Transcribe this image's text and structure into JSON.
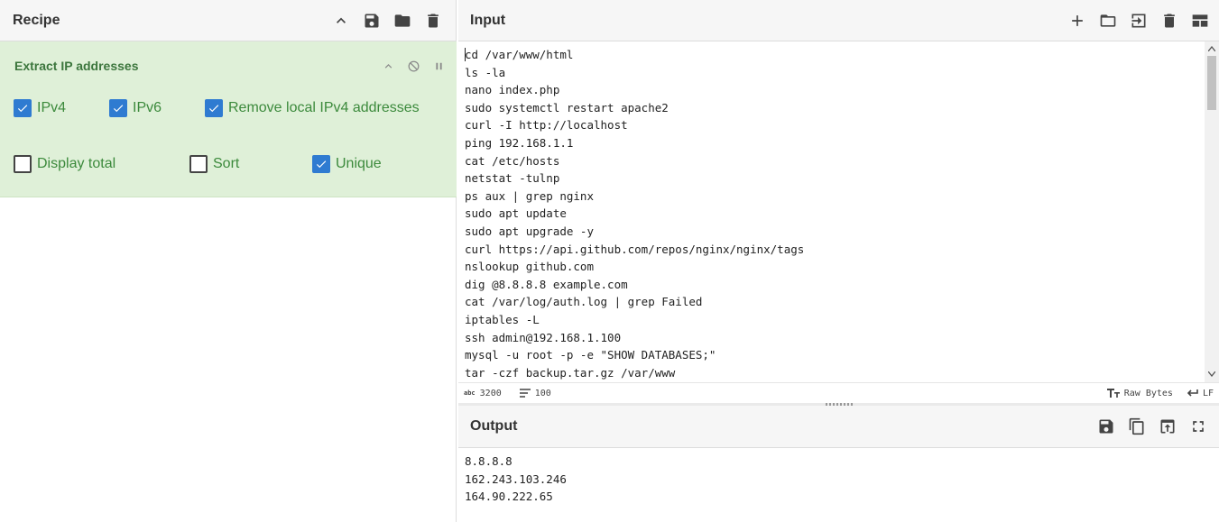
{
  "recipe": {
    "title": "Recipe",
    "operation": {
      "name": "Extract IP addresses",
      "options": [
        {
          "label": "IPv4",
          "checked": true
        },
        {
          "label": "IPv6",
          "checked": true
        },
        {
          "label": "Remove local IPv4 addresses",
          "checked": true
        },
        {
          "label": "Display total",
          "checked": false
        },
        {
          "label": "Sort",
          "checked": false
        },
        {
          "label": "Unique",
          "checked": true
        }
      ]
    }
  },
  "input": {
    "title": "Input",
    "lines": [
      "cd /var/www/html",
      "ls -la",
      "nano index.php",
      "sudo systemctl restart apache2",
      "curl -I http://localhost",
      "ping 192.168.1.1",
      "cat /etc/hosts",
      "netstat -tulnp",
      "ps aux | grep nginx",
      "sudo apt update",
      "sudo apt upgrade -y",
      "curl https://api.github.com/repos/nginx/nginx/tags",
      "nslookup github.com",
      "dig @8.8.8.8 example.com",
      "cat /var/log/auth.log | grep Failed",
      "iptables -L",
      "ssh admin@192.168.1.100",
      "mysql -u root -p -e \"SHOW DATABASES;\"",
      "tar -czf backup.tar.gz /var/www"
    ],
    "status": {
      "char_icon": "abc",
      "chars": "3200",
      "lines": "100",
      "encoding": "Raw Bytes",
      "eol": "LF"
    }
  },
  "output": {
    "title": "Output",
    "lines": [
      "8.8.8.8",
      "162.243.103.246",
      "164.90.222.65"
    ]
  },
  "colors": {
    "operation_bg": "#dff0d8",
    "operation_text": "#3c763d",
    "checkbox_checked": "#2f7bd1"
  }
}
